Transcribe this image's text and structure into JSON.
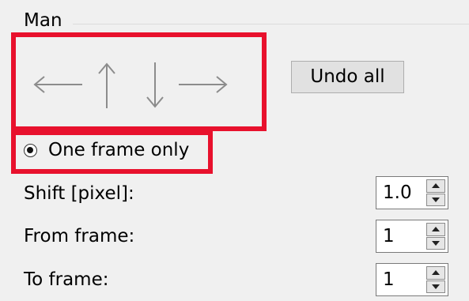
{
  "group": {
    "title": "Man"
  },
  "arrows": [
    {
      "icon": "arrow-left-icon",
      "glyph": "←"
    },
    {
      "icon": "arrow-up-icon",
      "glyph": "↑"
    },
    {
      "icon": "arrow-down-icon",
      "glyph": "↓"
    },
    {
      "icon": "arrow-right-icon",
      "glyph": "→"
    }
  ],
  "undo_button": {
    "label": "Undo all"
  },
  "radio": {
    "label": "One frame only",
    "selected": true
  },
  "fields": {
    "shift": {
      "label": "Shift [pixel]:",
      "value": "1.0"
    },
    "from_frame": {
      "label": "From frame:",
      "value": "1"
    },
    "to_frame": {
      "label": "To frame:",
      "value": "1"
    }
  },
  "colors": {
    "highlight": "#e8112d",
    "background": "#f0f0f0",
    "arrow": "#8c8c8c"
  }
}
